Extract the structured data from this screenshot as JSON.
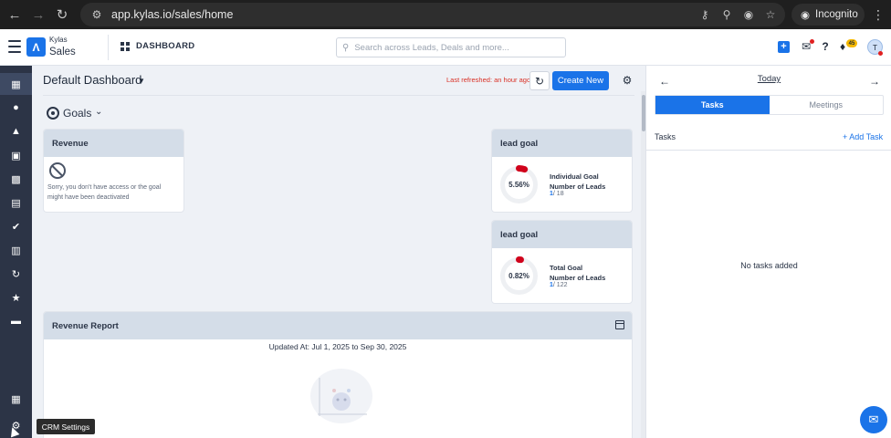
{
  "browser": {
    "url": "app.kylas.io/sales/home",
    "incognito_label": "Incognito",
    "icons": [
      "back-icon",
      "forward-icon",
      "reload-icon",
      "site-settings-icon",
      "password-key-icon",
      "zoom-icon",
      "eye-off-icon",
      "bookmark-star-icon",
      "incognito-icon",
      "kebab-menu-icon"
    ]
  },
  "header": {
    "brand_top": "Kylas",
    "brand_main": "Sales",
    "section": "DASHBOARD",
    "search_placeholder": "Search across Leads, Deals and more...",
    "notification_count": "45",
    "avatar_initial": "T"
  },
  "sidebar": {
    "items": [
      {
        "icon": "dashboard-icon"
      },
      {
        "icon": "user-icon"
      },
      {
        "icon": "leads-icon"
      },
      {
        "icon": "contact-card-icon"
      },
      {
        "icon": "company-icon"
      },
      {
        "icon": "deals-icon"
      },
      {
        "icon": "tasks-check-icon"
      },
      {
        "icon": "calendar-icon"
      },
      {
        "icon": "workflow-icon"
      },
      {
        "icon": "campaign-icon"
      },
      {
        "icon": "reports-icon"
      },
      {
        "icon": "apps-grid-icon"
      },
      {
        "icon": "settings-gear-icon"
      }
    ],
    "tooltip": "CRM Settings"
  },
  "dashboard": {
    "title": "Default Dashboard",
    "last_refreshed": "Last refreshed: an hour ago",
    "create_new": "Create New",
    "goals_label": "Goals",
    "revenue_card": {
      "title": "Revenue",
      "message": "Sorry, you don't have access or the goal might have been deactivated"
    },
    "goal_cards": [
      {
        "title": "lead goal",
        "percent": "5.56%",
        "progress": 0.0556,
        "name": "Individual Goal",
        "metric": "Number of Leads",
        "achieved": "1",
        "target": "/ 18"
      },
      {
        "title": "lead goal",
        "percent": "0.82%",
        "progress": 0.0082,
        "name": "Total Goal",
        "metric": "Number of Leads",
        "achieved": "1",
        "target": "/ 122"
      }
    ],
    "revenue_report": {
      "title": "Revenue Report",
      "updated": "Updated At: Jul 1, 2025 to Sep 30, 2025"
    }
  },
  "right_panel": {
    "date_label": "Today",
    "tabs": [
      "Tasks",
      "Meetings"
    ],
    "tasks_label": "Tasks",
    "add_task": "Add Task",
    "empty_state": "No tasks added"
  },
  "colors": {
    "accent": "#1a73e8",
    "sidebar": "#2c3446",
    "card_header": "#d4dde8",
    "goal_progress": "#d0021b",
    "alert_text": "#d93025"
  }
}
